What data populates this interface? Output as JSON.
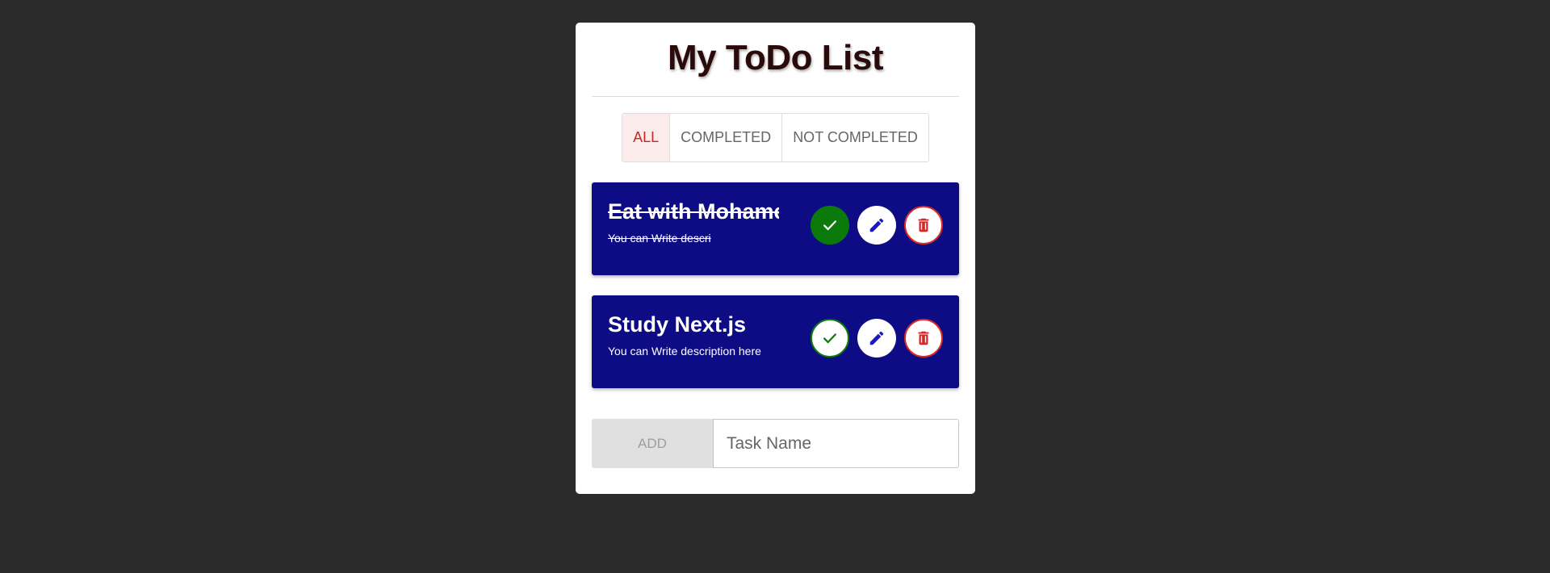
{
  "app": {
    "title": "My ToDo List"
  },
  "filters": [
    {
      "label": "ALL",
      "active": true
    },
    {
      "label": "COMPLETED",
      "active": false
    },
    {
      "label": "NOT COMPLETED",
      "active": false
    }
  ],
  "tasks": [
    {
      "name": "Eat with Mohame",
      "description": "You can Write descri",
      "completed": true,
      "actions": [
        "check-icon",
        "pencil-icon",
        "trash-icon"
      ]
    },
    {
      "name": "Study Next.js",
      "description": "You can Write description here",
      "completed": false,
      "actions": [
        "check-icon",
        "pencil-icon",
        "trash-icon"
      ]
    }
  ],
  "add_form": {
    "button_label": "ADD",
    "input_placeholder": "Task Name",
    "input_value": ""
  },
  "colors": {
    "page_background": "#2b2b2b",
    "task_background": "#0e0c85",
    "check_green": "#0b7a0b",
    "delete_red": "#d42a2a",
    "edit_blue": "#1a18c8",
    "active_filter_text": "#c62828",
    "active_filter_bg": "#fcebeb"
  }
}
